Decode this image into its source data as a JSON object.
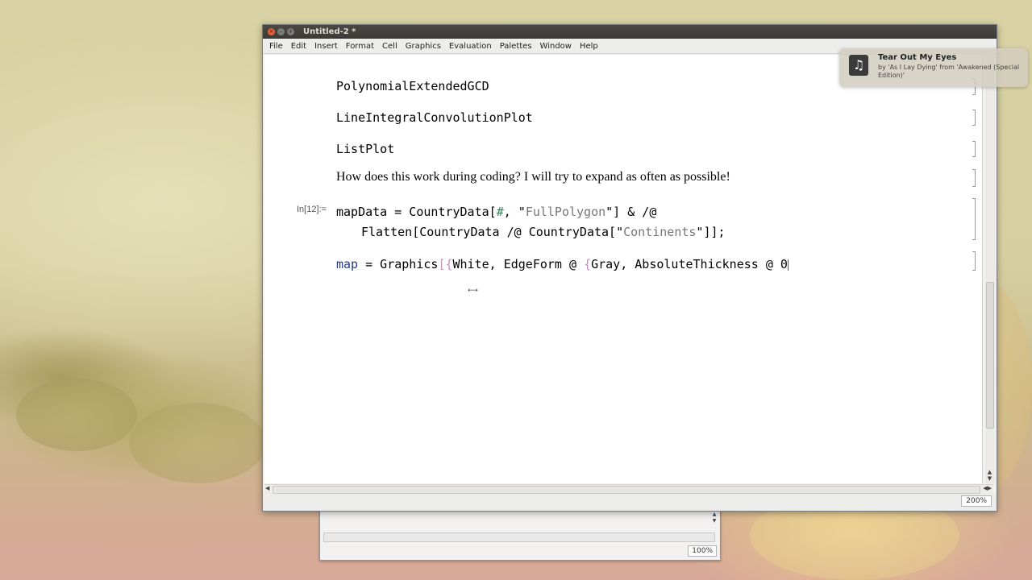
{
  "window": {
    "title": "Untitled-2 *",
    "close_glyph": "×",
    "minimize_glyph": "–",
    "maximize_glyph": "+"
  },
  "menu": [
    "File",
    "Edit",
    "Insert",
    "Format",
    "Cell",
    "Graphics",
    "Evaluation",
    "Palettes",
    "Window",
    "Help"
  ],
  "notebook": {
    "cells": [
      {
        "text": "PolynomialExtendedGCD"
      },
      {
        "text": "LineIntegralConvolutionPlot"
      },
      {
        "text": "ListPlot"
      },
      {
        "text": "How does this work during coding? I will try to expand as often as possible!"
      }
    ],
    "input_label": "In[12]:=",
    "input_line1": {
      "a": "mapData = CountryData[",
      "slot": "#",
      "b": ", \"",
      "str": "FullPolygon",
      "c": "\"] & /@"
    },
    "input_line2": {
      "a": "Flatten[CountryData /@ CountryData[\"",
      "str": "Continents",
      "b": "\"]];"
    },
    "map_line": {
      "var": "map",
      "a": " = Graphics",
      "brk": "[{",
      "b": "White, EdgeForm @ ",
      "brk2": "{",
      "c": "Gray, AbsoluteThickness @ 0"
    }
  },
  "status": {
    "zoom": "200%",
    "back_zoom": "100%"
  },
  "notification": {
    "title": "Tear Out My Eyes",
    "body": "by 'As I Lay Dying' from 'Awakened (Special Edition)'",
    "icon": "music-note-icon"
  },
  "colors": {
    "titlebar": "#3b3a36",
    "close": "#e2603a",
    "string": "#777777",
    "variable": "#223a8c"
  }
}
